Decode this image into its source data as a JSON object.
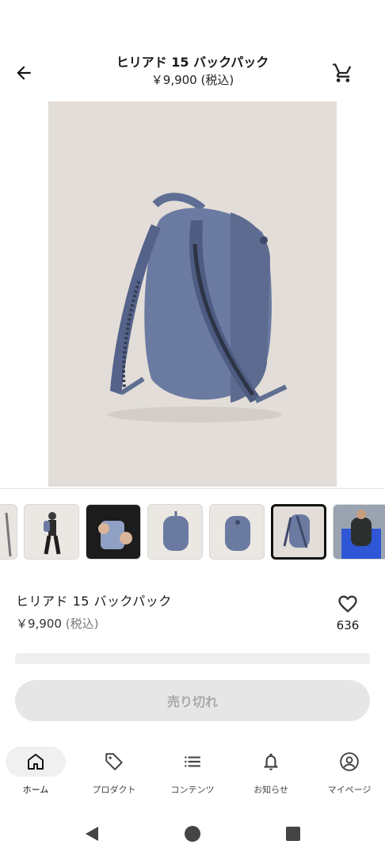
{
  "header": {
    "title": "ヒリアド 15 バックパック",
    "price": "￥9,900 (税込)"
  },
  "product": {
    "name": "ヒリアド 15 バックパック",
    "price_amount": "￥9,900",
    "price_tax": "(税込)",
    "favorite_count": "636",
    "sold_out_label": "売り切れ"
  },
  "thumbnails": {
    "count": 7,
    "selected_index": 5
  },
  "bottom_nav": [
    {
      "label": "ホーム",
      "icon": "home-icon",
      "active": true
    },
    {
      "label": "プロダクト",
      "icon": "tag-icon",
      "active": false
    },
    {
      "label": "コンテンツ",
      "icon": "list-icon",
      "active": false
    },
    {
      "label": "お知らせ",
      "icon": "bell-icon",
      "active": false
    },
    {
      "label": "マイページ",
      "icon": "account-icon",
      "active": false
    }
  ],
  "colors": {
    "accent": "#111111",
    "bag_blue": "#6b7aa1",
    "image_bg": "#e2ddd8",
    "disabled_button": "#e6e6e6"
  }
}
